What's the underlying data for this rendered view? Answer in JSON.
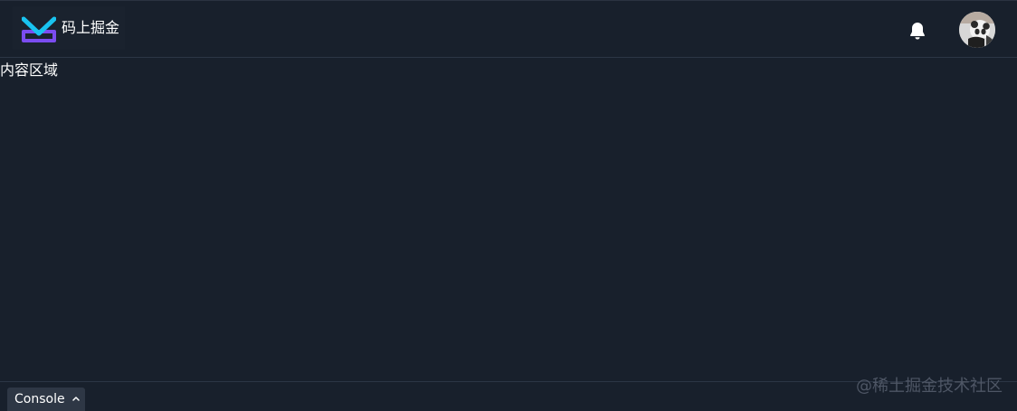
{
  "app": {
    "title": "码上掘金",
    "colors": {
      "background": "#18202c",
      "logo_blue": "#1e80ff",
      "logo_cyan": "#19c3f0",
      "logo_purple": "#7b4cf0",
      "text": "#ffffff",
      "watermark": "#4e5665"
    }
  },
  "header": {
    "logo_icon": "juejin-logo-icon",
    "notification_icon": "bell-icon",
    "avatar_icon": "user-avatar"
  },
  "main": {
    "content_text": "内容区域"
  },
  "footer": {
    "console_label": "Console",
    "console_icon": "chevron-up-icon",
    "watermark": "@稀土掘金技术社区"
  }
}
